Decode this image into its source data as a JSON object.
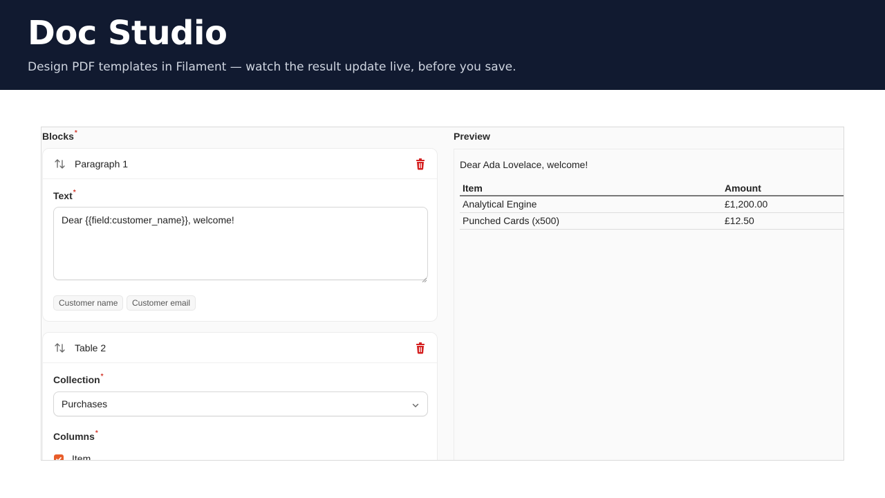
{
  "header": {
    "title": "Doc Studio",
    "subtitle": "Design PDF templates in Filament — watch the result update live, before you save."
  },
  "blocks": {
    "label": "Blocks",
    "required_mark": "*",
    "paragraph": {
      "title": "Paragraph 1",
      "text_label": "Text",
      "text_value": "Dear {{field:customer_name}}, welcome!",
      "chips": [
        "Customer name",
        "Customer email"
      ]
    },
    "table": {
      "title": "Table 2",
      "collection_label": "Collection",
      "collection_value": "Purchases",
      "columns_label": "Columns",
      "column_item": {
        "label": "Item",
        "checked": true
      }
    }
  },
  "preview": {
    "label": "Preview",
    "greeting": "Dear Ada Lovelace, welcome!",
    "table": {
      "headers": [
        "Item",
        "Amount"
      ],
      "rows": [
        [
          "Analytical Engine",
          "£1,200.00"
        ],
        [
          "Punched Cards (x500)",
          "£12.50"
        ]
      ]
    }
  },
  "colors": {
    "header_bg": "#111a30",
    "accent": "#e85d2a",
    "danger": "#d42020",
    "required": "#d43a2f"
  },
  "icons": {
    "reorder": "arrows-up-down-icon",
    "delete": "trash-icon",
    "dropdown": "chevron-down-icon",
    "check": "check-icon"
  }
}
